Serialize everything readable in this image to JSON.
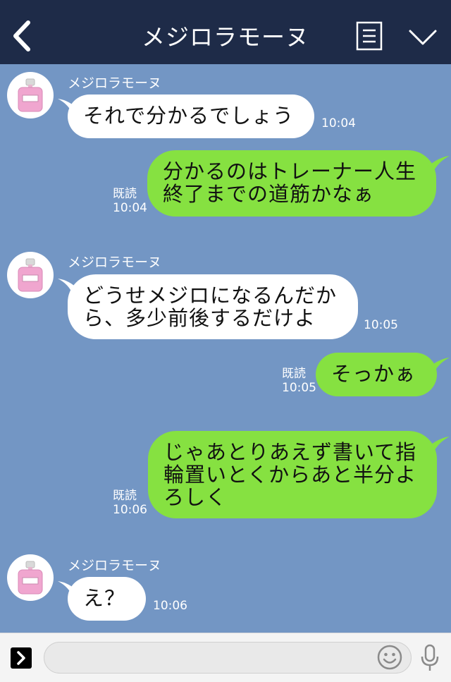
{
  "header": {
    "title": "メジロラモーヌ",
    "back_icon": "chevron-left-icon",
    "menu_icon": "notes-icon",
    "expand_icon": "chevron-down-icon",
    "background": "#1e2b48"
  },
  "chat": {
    "background": "#7396c4",
    "incoming_bubble_color": "#ffffff",
    "outgoing_bubble_color": "#86e141",
    "messages": [
      {
        "direction": "in",
        "sender": "メジロラモーヌ",
        "lines": [
          "それで分かるでしょう"
        ],
        "time": "10:04"
      },
      {
        "direction": "out",
        "lines": [
          "分かるのはトレーナー人生",
          "終了までの道筋かなぁ"
        ],
        "read": "既読",
        "time": "10:04"
      },
      {
        "direction": "in",
        "sender": "メジロラモーヌ",
        "lines": [
          "どうせメジロになるんだか",
          "ら、多少前後するだけよ"
        ],
        "time": "10:05"
      },
      {
        "direction": "out",
        "lines": [
          "そっかぁ"
        ],
        "read": "既読",
        "time": "10:05"
      },
      {
        "direction": "out",
        "lines": [
          "じゃあとりあえず書いて指",
          "輪置いとくからあと半分よ",
          "ろしく"
        ],
        "read": "既読",
        "time": "10:06"
      },
      {
        "direction": "in",
        "sender": "メジロラモーヌ",
        "lines": [
          "え？"
        ],
        "time": "10:06"
      }
    ]
  },
  "footer": {
    "input_value": "",
    "input_placeholder": "",
    "plus_icon": "expand-arrow-icon",
    "emoji_icon": "smiley-icon",
    "mic_icon": "microphone-icon"
  }
}
